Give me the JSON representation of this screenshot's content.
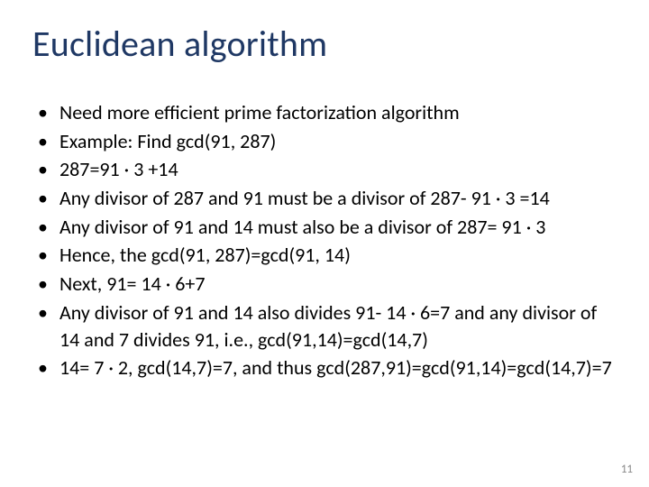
{
  "slide": {
    "title": "Euclidean algorithm",
    "bullets": [
      "Need more efficient prime factorization algorithm",
      "Example: Find gcd(91, 287)",
      "287=91 · 3 +14",
      "Any divisor of 287 and 91 must be a divisor of 287- 91 · 3 =14",
      "Any divisor of 91 and 14 must also be a divisor of 287= 91 · 3",
      "Hence, the gcd(91, 287)=gcd(91, 14)",
      "Next, 91= 14 · 6+7",
      "Any divisor of 91 and 14 also divides 91- 14 · 6=7 and any divisor of 14 and 7 divides 91, i.e., gcd(91,14)=gcd(14,7)",
      "14= 7 · 2, gcd(14,7)=7, and thus gcd(287,91)=gcd(91,14)=gcd(14,7)=7"
    ],
    "page_number": "11"
  }
}
